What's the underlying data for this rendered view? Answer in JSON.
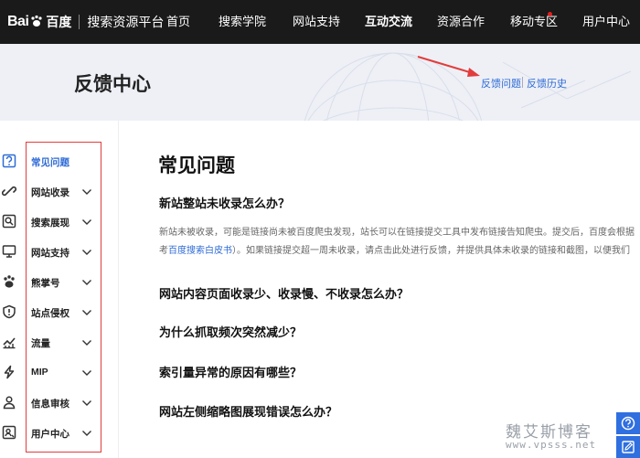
{
  "header": {
    "logo_bai": "Bai",
    "logo_du": "百度",
    "platform_title": "搜索资源平台",
    "nav": [
      {
        "label": "首页"
      },
      {
        "label": "搜索学院"
      },
      {
        "label": "网站支持"
      },
      {
        "label": "互动交流",
        "active": true
      },
      {
        "label": "资源合作"
      },
      {
        "label": "移动专区",
        "has_dot": true
      },
      {
        "label": "用户中心"
      }
    ]
  },
  "banner": {
    "title": "反馈中心",
    "links": [
      {
        "label": "反馈问题"
      },
      {
        "label": "反馈历史"
      }
    ]
  },
  "sidebar": {
    "items": [
      {
        "label": "常见问题",
        "icon": "question-icon",
        "active": true,
        "has_chevron": false
      },
      {
        "label": "网站收录",
        "icon": "link-icon",
        "has_chevron": true
      },
      {
        "label": "搜索展现",
        "icon": "search-display-icon",
        "has_chevron": true
      },
      {
        "label": "网站支持",
        "icon": "monitor-icon",
        "has_chevron": true
      },
      {
        "label": "熊掌号",
        "icon": "paw-icon",
        "has_chevron": true
      },
      {
        "label": "站点侵权",
        "icon": "alert-icon",
        "has_chevron": true
      },
      {
        "label": "流量",
        "icon": "chart-icon",
        "has_chevron": true
      },
      {
        "label": "MIP",
        "icon": "bolt-icon",
        "has_chevron": true
      },
      {
        "label": "信息审核",
        "icon": "user-review-icon",
        "has_chevron": true
      },
      {
        "label": "用户中心",
        "icon": "user-center-icon",
        "has_chevron": true
      }
    ]
  },
  "main": {
    "title": "常见问题",
    "faq": [
      {
        "question": "新站整站未收录怎么办？",
        "answer_line1": "新站未被收录，可能是链接尚未被百度爬虫发现，站长可以在链接提交工具中发布链接告知爬虫。提交后，百度会根据",
        "answer_line2_pre": "考",
        "answer_line2_link": "百度搜索白皮书",
        "answer_line2_post": "）。如果链接提交超一周未收录，请点击此处进行反馈，并提供具体未收录的链接和截图，以便我们"
      },
      {
        "question": "网站内容页面收录少、收录慢、不收录怎么办？"
      },
      {
        "question": "为什么抓取频次突然减少？"
      },
      {
        "question": "索引量异常的原因有哪些？"
      },
      {
        "question": "网站左侧缩略图展现错误怎么办？"
      }
    ]
  },
  "watermark": {
    "cn": "魏艾斯博客",
    "en": "www.vpsss.net"
  },
  "colors": {
    "topbar_bg": "#1a1a1a",
    "accent_blue": "#2e6bd6",
    "highlight_red": "#e23c3c"
  }
}
